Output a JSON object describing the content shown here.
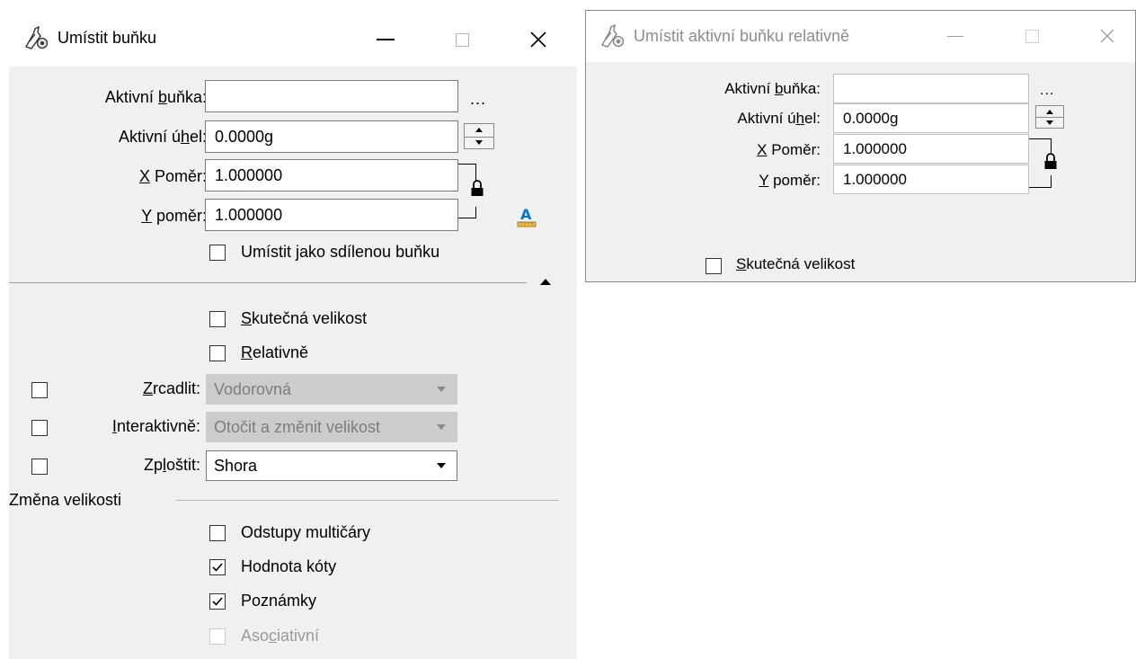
{
  "colors": {
    "panel": "#f0f0f0",
    "disabled_combo": "#cccccc",
    "disabled_text": "#7d7d7d",
    "accent_icon": "#0078d7"
  },
  "win1": {
    "title": "Umístit buňku",
    "active_cell": {
      "pre": "Aktivní ",
      "acc": "b",
      "post": "uňka:",
      "value": "",
      "browse": "..."
    },
    "active_angle": {
      "pre": "Aktivní ú",
      "acc": "h",
      "post": "el:",
      "value": "0.0000g"
    },
    "x_scale": {
      "acc": "X",
      "post": " Poměr:",
      "value": "1.000000"
    },
    "y_scale": {
      "acc": "Y",
      "post": " poměr:",
      "value": "1.000000"
    },
    "shared_cell": {
      "label": "Umístit jako sdílenou buňku",
      "checked": false
    },
    "true_scale": {
      "acc": "S",
      "post": "kutečná velikost",
      "checked": false
    },
    "relative": {
      "acc": "R",
      "post": "elativně",
      "checked": false
    },
    "mirror": {
      "acc": "Z",
      "post": "rcadlit:",
      "value": "Vodorovná",
      "checked": false,
      "enabled": false
    },
    "interactive": {
      "acc": "I",
      "post": "nteraktivně:",
      "value": "Otočit a změnit velikost",
      "checked": false,
      "enabled": false
    },
    "flatten": {
      "pre": "Zp",
      "acc": "l",
      "post": "oštit:",
      "value": "Shora",
      "checked": false,
      "enabled": true
    },
    "scaling_group": "Změna velikosti",
    "multiline_offsets": {
      "label": "Odstupy multičáry",
      "checked": false
    },
    "dimension_values": {
      "label": "Hodnota kóty",
      "checked": true
    },
    "annotations": {
      "label": "Poznámky",
      "checked": true
    },
    "associative": {
      "pre": "Aso",
      "acc": "c",
      "post": "iativní",
      "checked": false,
      "enabled": false
    }
  },
  "win2": {
    "title": "Umístit aktivní buňku relativně",
    "active_cell": {
      "pre": "Aktivní ",
      "acc": "b",
      "post": "uňka:",
      "value": "",
      "browse": "..."
    },
    "active_angle": {
      "pre": "Aktivní ú",
      "acc": "h",
      "post": "el:",
      "value": "0.0000g"
    },
    "x_scale": {
      "acc": "X",
      "post": " Poměr:",
      "value": "1.000000"
    },
    "y_scale": {
      "acc": "Y",
      "post": " poměr:",
      "value": "1.000000"
    },
    "true_scale": {
      "acc": "S",
      "post": "kutečná velikost",
      "checked": false
    }
  }
}
